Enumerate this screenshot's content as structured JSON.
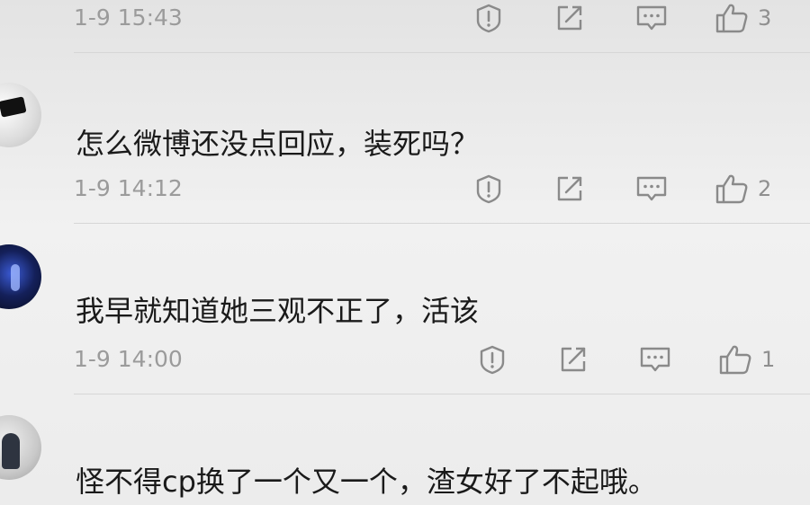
{
  "comments": [
    {
      "username": "",
      "text": "",
      "time": "1-9 15:43",
      "likes": "3"
    },
    {
      "username": "",
      "text": "怎么微博还没点回应，装死吗？",
      "time": "1-9 14:12",
      "likes": "2"
    },
    {
      "username": "",
      "text": "我早就知道她三观不正了，活该",
      "time": "1-9 14:00",
      "likes": "1"
    },
    {
      "username": "",
      "text": "怪不得cp换了一个又一个，渣女好了不起哦。",
      "time": "",
      "likes": ""
    }
  ],
  "icons": {
    "report": "report-icon",
    "share": "share-icon",
    "reply": "comment-icon",
    "like": "thumbs-up-icon"
  },
  "colors": {
    "text": "#1a1a1a",
    "meta": "#9b9b9b",
    "icon": "#8a8a8a"
  }
}
